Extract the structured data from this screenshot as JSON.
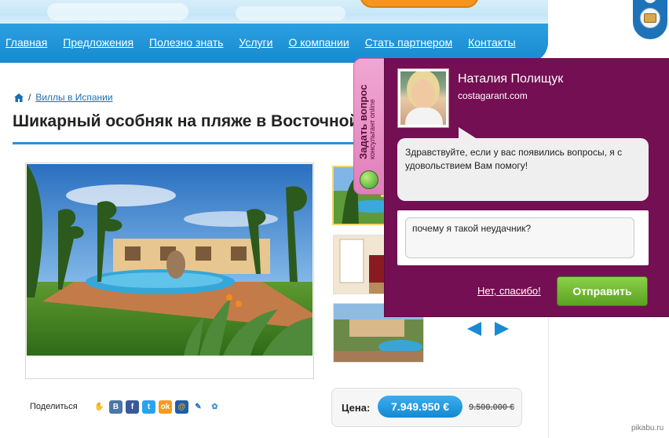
{
  "header": {
    "nav": [
      "Главная",
      "Предложения",
      "Полезно знать",
      "Услуги",
      "О компании",
      "Стать партнером",
      "Контакты"
    ]
  },
  "breadcrumb": {
    "link": "Виллы в Испании",
    "separator": "/"
  },
  "page": {
    "title": "Шикарный особняк на пляже в Восточной"
  },
  "share": {
    "label": "Поделиться",
    "icons": [
      "odnoklassniki-icon",
      "vkontakte-icon",
      "facebook-icon",
      "twitter-icon",
      "odnoklassniki-ok-icon",
      "mailru-icon",
      "livejournal-icon",
      "settings-share-icon"
    ]
  },
  "price": {
    "label": "Цена:",
    "current": "7.949.950 €",
    "old": "9.500.000 €"
  },
  "chat": {
    "tab_title": "Задать вопрос",
    "tab_subtitle": "консультант online",
    "agent_name": "Наталия Полищук",
    "agent_site": "costagarant.com",
    "greeting": "Здравствуйте, если у вас появились вопросы, я с удовольствием Вам помогу!",
    "input_value": "почему я такой неудачник?",
    "decline_label": "Нет, спасибо!",
    "send_label": "Отправить"
  },
  "watermark": "pikabu.ru",
  "colors": {
    "nav_blue": "#178ad0",
    "chat_purple": "#730f52",
    "send_green": "#5aa220",
    "price_blue": "#1589d0"
  }
}
